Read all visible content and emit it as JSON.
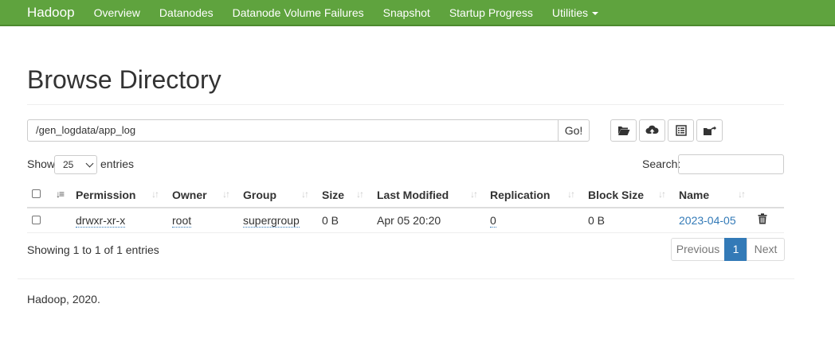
{
  "navbar": {
    "brand": "Hadoop",
    "items": [
      "Overview",
      "Datanodes",
      "Datanode Volume Failures",
      "Snapshot",
      "Startup Progress",
      "Utilities"
    ]
  },
  "page": {
    "title": "Browse Directory"
  },
  "path": {
    "value": "/gen_logdata/app_log",
    "go_label": "Go!"
  },
  "toolbar": {
    "icons": [
      "folder-open-icon",
      "cloud-upload-icon",
      "list-icon",
      "folder-share-icon"
    ]
  },
  "entries": {
    "show_label": "Show",
    "selected": "25",
    "suffix_label": "entries"
  },
  "search": {
    "label": "Search:",
    "value": ""
  },
  "table": {
    "columns": [
      "Permission",
      "Owner",
      "Group",
      "Size",
      "Last Modified",
      "Replication",
      "Block Size",
      "Name"
    ],
    "rows": [
      {
        "permission": "drwxr-xr-x",
        "owner": "root",
        "group": "supergroup",
        "size": "0 B",
        "last_modified": "Apr 05 20:20",
        "replication": "0",
        "block_size": "0 B",
        "name": "2023-04-05"
      }
    ]
  },
  "info": "Showing 1 to 1 of 1 entries",
  "pagination": {
    "previous": "Previous",
    "current": "1",
    "next": "Next"
  },
  "footer": "Hadoop, 2020.",
  "colors": {
    "navbar": "#5fa33e",
    "link": "#337ab7",
    "active_page": "#337ab7"
  }
}
